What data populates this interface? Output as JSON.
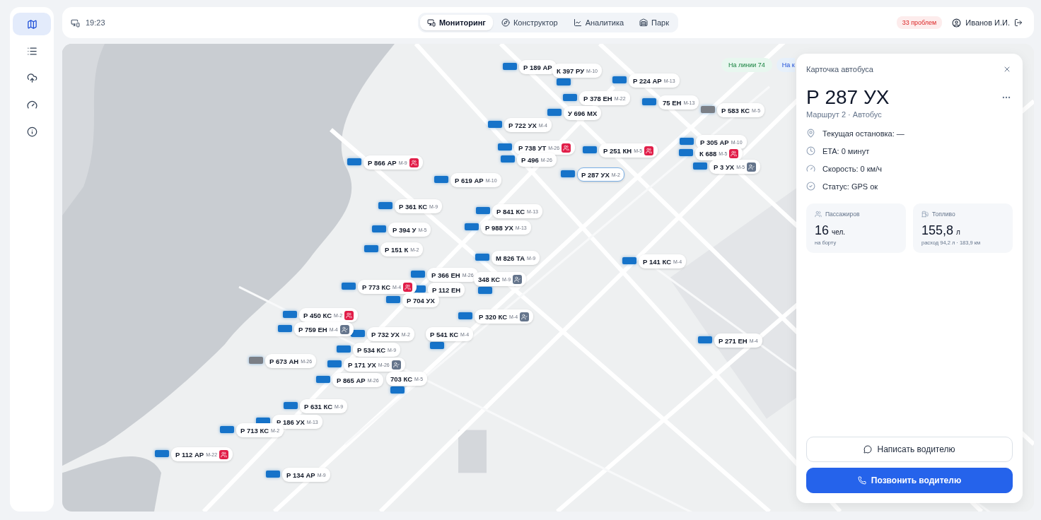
{
  "sidebar": {
    "items": [
      {
        "selected": true
      },
      {
        "selected": false
      },
      {
        "selected": false
      },
      {
        "selected": false
      },
      {
        "selected": false
      }
    ]
  },
  "topbar": {
    "time": "19:23",
    "tabs": [
      {
        "label": "Мониторинг",
        "selected": true
      },
      {
        "label": "Конструктор",
        "selected": false
      },
      {
        "label": "Аналитика",
        "selected": false
      },
      {
        "label": "Парк",
        "selected": false
      }
    ],
    "problems": "33 проблем",
    "user": "Иванов И.И."
  },
  "map": {
    "chips": [
      {
        "label": "На линии",
        "count": "74",
        "kind": "online"
      },
      {
        "label": "На к",
        "kind": "other"
      }
    ],
    "markers": [
      {
        "plate": "Р 189 АР",
        "kind": "plain",
        "selected": false,
        "offline": false
      },
      {
        "plate": "К 397 РУ",
        "route": "М-10",
        "kind": "plain",
        "selected": false,
        "offline": false
      },
      {
        "plate": "Р 224 АР",
        "route": "М-13",
        "kind": "plain",
        "selected": false,
        "offline": false
      },
      {
        "plate": "Р 378 ЕН",
        "route": "М-22",
        "kind": "plain",
        "selected": false,
        "offline": false
      },
      {
        "plate": "75 ЕН",
        "route": "М-13",
        "kind": "plain",
        "selected": false,
        "offline": false
      },
      {
        "plate": "У 696 МХ",
        "kind": "plain",
        "selected": false,
        "offline": false
      },
      {
        "plate": "Р 583 КС",
        "route": "М-5",
        "kind": "plain",
        "selected": false,
        "offline": true
      },
      {
        "plate": "Р 722 УХ",
        "route": "М-4",
        "kind": "plain",
        "selected": false,
        "offline": false
      },
      {
        "plate": "Р 305 АР",
        "route": "М-10",
        "kind": "plain",
        "selected": false,
        "offline": false
      },
      {
        "plate": "Р 738 УТ",
        "route": "М-26",
        "kind": "alert",
        "selected": false,
        "offline": false
      },
      {
        "plate": "Р 251 КН",
        "route": "М-5",
        "kind": "alert",
        "selected": false,
        "offline": false
      },
      {
        "plate": "К 688",
        "route": "М-5",
        "kind": "alert",
        "selected": false,
        "offline": false
      },
      {
        "plate": "Р 496",
        "route": "М-26",
        "kind": "plain",
        "selected": false,
        "offline": false
      },
      {
        "plate": "Р 866 АР",
        "route": "М-9",
        "kind": "alert",
        "selected": false,
        "offline": false
      },
      {
        "plate": "Р 3 УХ",
        "route": "М-5",
        "kind": "person",
        "selected": false,
        "offline": false
      },
      {
        "plate": "Р 287 УХ",
        "route": "М-2",
        "kind": "plain",
        "selected": true,
        "offline": false
      },
      {
        "plate": "Р 619 АР",
        "route": "М-10",
        "kind": "plain",
        "selected": false,
        "offline": false
      },
      {
        "plate": "Р 361 КС",
        "route": "М-9",
        "kind": "plain",
        "selected": false,
        "offline": false
      },
      {
        "plate": "Р 841 КС",
        "route": "М-13",
        "kind": "plain",
        "selected": false,
        "offline": false
      },
      {
        "plate": "Р 988 УХ",
        "route": "М-13",
        "kind": "plain",
        "selected": false,
        "offline": false
      },
      {
        "plate": "Р 394 У",
        "route": "М-5",
        "kind": "plain",
        "selected": false,
        "offline": false
      },
      {
        "plate": "Р 151 К",
        "route": "М-2",
        "kind": "plain",
        "selected": false,
        "offline": false
      },
      {
        "plate": "М 826 ТА",
        "route": "М-9",
        "kind": "plain",
        "selected": false,
        "offline": false
      },
      {
        "plate": "Р 141 КС",
        "route": "М-4",
        "kind": "plain",
        "selected": false,
        "offline": false
      },
      {
        "plate": "Р 366 ЕН",
        "route": "М-26",
        "kind": "plain",
        "selected": false,
        "offline": false
      },
      {
        "plate": "348 КС",
        "route": "М-9",
        "kind": "person",
        "selected": false,
        "offline": false
      },
      {
        "plate": "Р 773 КС",
        "route": "М-4",
        "kind": "alert",
        "selected": false,
        "offline": false
      },
      {
        "plate": "Р 112 ЕН",
        "kind": "plain",
        "selected": false,
        "offline": false
      },
      {
        "plate": "Р 704 УХ",
        "kind": "plain",
        "selected": false,
        "offline": false
      },
      {
        "plate": "Р 450 КС",
        "route": "М-2",
        "kind": "alert",
        "selected": false,
        "offline": false
      },
      {
        "plate": "Р 320 КС",
        "route": "М-4",
        "kind": "person",
        "selected": false,
        "offline": false
      },
      {
        "plate": "Р 759 ЕН",
        "route": "М-4",
        "kind": "person",
        "selected": false,
        "offline": false
      },
      {
        "plate": "Р 732 УХ",
        "route": "М-2",
        "kind": "plain",
        "selected": false,
        "offline": false
      },
      {
        "plate": "Р 541 КС",
        "route": "М-4",
        "kind": "plain",
        "selected": false,
        "offline": false
      },
      {
        "plate": "Р 271 ЕН",
        "route": "М-4",
        "kind": "plain",
        "selected": false,
        "offline": false
      },
      {
        "plate": "Р 534 КС",
        "route": "М-9",
        "kind": "plain",
        "selected": false,
        "offline": false
      },
      {
        "plate": "Р 673 АН",
        "route": "М-26",
        "kind": "plain",
        "selected": false,
        "offline": true
      },
      {
        "plate": "Р 171 УХ",
        "route": "М-26",
        "kind": "person",
        "selected": false,
        "offline": false
      },
      {
        "plate": "Р 865 АР",
        "route": "М-26",
        "kind": "plain",
        "selected": false,
        "offline": false
      },
      {
        "plate": "703 КС",
        "route": "М-5",
        "kind": "plain",
        "selected": false,
        "offline": false
      },
      {
        "plate": "Р 631 КС",
        "route": "М-9",
        "kind": "plain",
        "selected": false,
        "offline": false
      },
      {
        "plate": "Р 186 УХ",
        "route": "М-13",
        "kind": "plain",
        "selected": false,
        "offline": false
      },
      {
        "plate": "Р 713 КС",
        "route": "М-2",
        "kind": "plain",
        "selected": false,
        "offline": false
      },
      {
        "plate": "Р 112 АР",
        "route": "М-22",
        "kind": "alert",
        "selected": false,
        "offline": false
      },
      {
        "plate": "Р 134 АР",
        "route": "М-9",
        "kind": "plain",
        "selected": false,
        "offline": false
      }
    ]
  },
  "bus_card": {
    "title": "Карточка автобуса",
    "plate": "Р 287 УХ",
    "subtitle": "Маршрут 2 · Автобус",
    "info": [
      {
        "kind": "stop",
        "text": "Текущая остановка: —"
      },
      {
        "kind": "eta",
        "text": "ETA: 0 минут"
      },
      {
        "kind": "speed",
        "text": "Скорость: 0 км/ч"
      },
      {
        "kind": "status",
        "text": "Статус: GPS ок"
      }
    ],
    "stats": [
      {
        "kind": "passengers",
        "label": "Пассажиров",
        "value": "16",
        "unit": "чел.",
        "note": "на борту"
      },
      {
        "kind": "fuel",
        "label": "Топливо",
        "value": "155,8",
        "unit": "л",
        "note": "расход 94,2 л · 183,9 км"
      }
    ],
    "buttons": [
      {
        "kind": "secondary",
        "label": "Написать водителю"
      },
      {
        "kind": "primary",
        "label": "Позвонить водителю"
      }
    ]
  }
}
